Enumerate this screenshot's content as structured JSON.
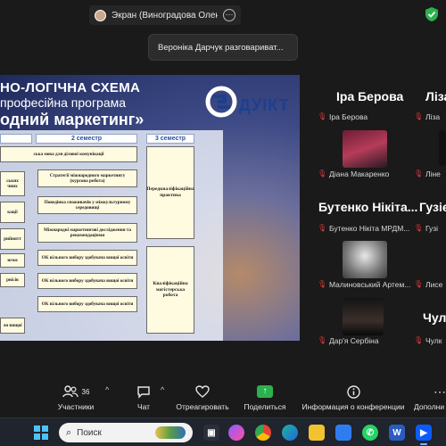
{
  "topbar": {
    "share_text": "Экран (Виноградова Олена Волс",
    "more": "⋯",
    "toast": "Вероніка Дарчук разговариват..."
  },
  "slide": {
    "title_line1": "НО-ЛОГІЧНА СХЕМА",
    "title_line2": "професійна програма",
    "title_line3": "одний маркетинг»",
    "logo_text": "ДУІКТ",
    "headers": [
      "",
      "2 семестр",
      "3 семестр"
    ],
    "col1": [
      "ська мова для ділової комунікації",
      "ських\nчних",
      "кації",
      "рийнятт",
      "нгом",
      "рвісів",
      "ля вищої"
    ],
    "col2": [
      "Стратегії міжнародного маркетингу (курсова робота)",
      "Поведінка споживачів у міжкультурному середовищі",
      "Міжнародні маркетингові дослідження та рекомендаціями",
      "ОК вільного вибору здобувача вищої освіти",
      "ОК вільного вибору здобувача вищої освіти",
      "ОК вільного вибору здобувача вищої освіти"
    ],
    "col3": [
      "Передкваліфікаційна практика",
      "Кваліфікаційна магістерська робота"
    ]
  },
  "participants": [
    {
      "title": "Іра Берова",
      "label": "Іра Берова"
    },
    {
      "title": "",
      "label": "Діана Макаренко"
    },
    {
      "title": "Бутенко Нікіта...",
      "label": "Бутенко Нікіта МРДМ..."
    },
    {
      "title": "",
      "label": "Малиновський Артем..."
    },
    {
      "title": "",
      "label": "Дар'я Сербіна"
    },
    {
      "title": "Ліза",
      "label": "Ліза"
    },
    {
      "title": "",
      "label": "Ліне"
    },
    {
      "title": "Гузіє",
      "label": "Гузі"
    },
    {
      "title": "",
      "label": "Лисе"
    },
    {
      "title": "Чулк",
      "label": "Чулк"
    }
  ],
  "toolbar": {
    "participants_label": "Участники",
    "participants_count": "36",
    "chat_label": "Чат",
    "react_label": "Отреагировать",
    "share_label": "Поделиться",
    "info_label": "Информация о конференции",
    "more_label": "Дополни"
  },
  "taskbar": {
    "search_label": "Поиск",
    "apps": [
      "chrome",
      "edge",
      "files",
      "notepad",
      "whatsapp",
      "word",
      "zoom"
    ]
  },
  "colors": {
    "mic_muted": "#e03b3b",
    "share_green": "#2bb24c",
    "accent_blue": "#4cc2ff"
  }
}
